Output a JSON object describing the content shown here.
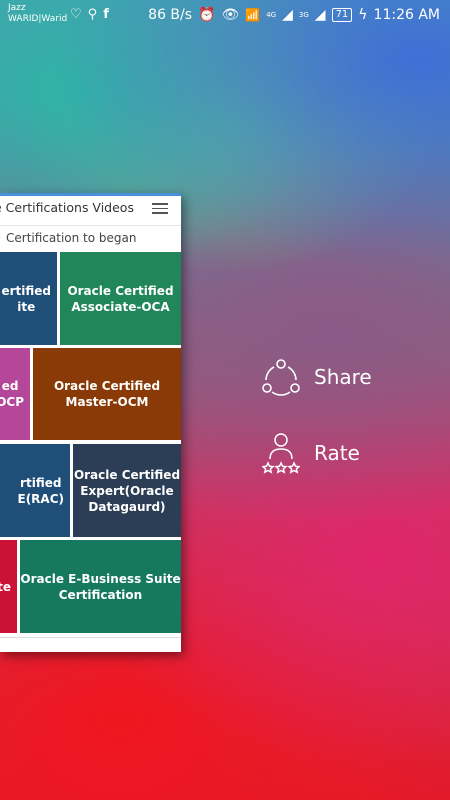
{
  "statusbar": {
    "carrier1": "Jazz",
    "carrier2": "WARID|Warid",
    "speed": "86 B/s",
    "net1": "4G",
    "net2": "3G",
    "battery": "71",
    "time": "11:26 AM"
  },
  "panel": {
    "title": "e Certifications Videos",
    "subtitle": "Certification to began",
    "tiles": [
      {
        "label": "ertified\nite",
        "color": "#1f4f78"
      },
      {
        "label": "Oracle Certified\nAssociate-OCA",
        "color": "#21865a"
      },
      {
        "label": "ed\nOCP",
        "color": "#b5479a"
      },
      {
        "label": "Oracle Certified\nMaster-OCM",
        "color": "#8a3a06"
      },
      {
        "label": "rtified\nE(RAC)",
        "color": "#1f4f78"
      },
      {
        "label": "Oracle Certified\nExpert(Oracle\nDatagaurd)",
        "color": "#2c3e55"
      },
      {
        "label": "ate",
        "color": "#cc1137"
      },
      {
        "label": "Oracle E-Business Suite\nCertification",
        "color": "#177860"
      }
    ]
  },
  "actions": {
    "share_label": "Share",
    "rate_label": "Rate"
  }
}
